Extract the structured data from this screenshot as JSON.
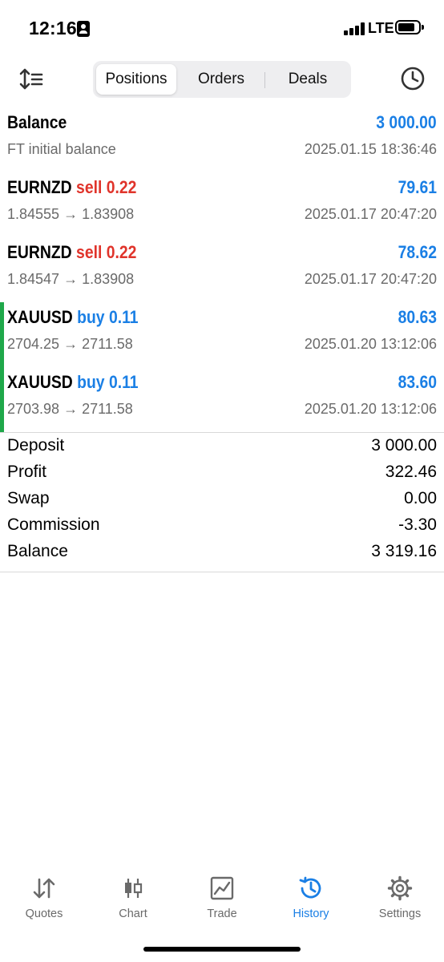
{
  "status_bar": {
    "time": "12:16",
    "network": "LTE"
  },
  "header": {
    "tabs": [
      {
        "label": "Positions",
        "active": true
      },
      {
        "label": "Orders",
        "active": false
      },
      {
        "label": "Deals",
        "active": false
      }
    ],
    "icons": {
      "sort": "sort-icon",
      "history_period": "clock-icon"
    }
  },
  "rows": [
    {
      "symbol": "Balance",
      "side": "",
      "value": "3 000.00",
      "detail": "FT initial balance",
      "time": "2025.01.15 18:36:46",
      "accent": false
    },
    {
      "symbol": "EURNZD",
      "side": "sell 0.22",
      "side_type": "sell",
      "value": "79.61",
      "detail": "1.84555 → 1.83908",
      "time": "2025.01.17 20:47:20",
      "accent": false
    },
    {
      "symbol": "EURNZD",
      "side": "sell 0.22",
      "side_type": "sell",
      "value": "78.62",
      "detail": "1.84547 → 1.83908",
      "time": "2025.01.17 20:47:20",
      "accent": false
    },
    {
      "symbol": "XAUUSD",
      "side": "buy 0.11",
      "side_type": "buy",
      "value": "80.63",
      "detail": "2704.25 → 2711.58",
      "time": "2025.01.20 13:12:06",
      "accent": true
    },
    {
      "symbol": "XAUUSD",
      "side": "buy 0.11",
      "side_type": "buy",
      "value": "83.60",
      "detail": "2703.98 → 2711.58",
      "time": "2025.01.20 13:12:06",
      "accent": true
    }
  ],
  "summary": [
    {
      "label": "Deposit",
      "value": "3 000.00"
    },
    {
      "label": "Profit",
      "value": "322.46"
    },
    {
      "label": "Swap",
      "value": "0.00"
    },
    {
      "label": "Commission",
      "value": "-3.30"
    },
    {
      "label": "Balance",
      "value": "3 319.16"
    }
  ],
  "tabbar": [
    {
      "label": "Quotes",
      "icon": "quotes-icon",
      "active": false
    },
    {
      "label": "Chart",
      "icon": "chart-icon",
      "active": false
    },
    {
      "label": "Trade",
      "icon": "trade-icon",
      "active": false
    },
    {
      "label": "History",
      "icon": "history-icon",
      "active": true
    },
    {
      "label": "Settings",
      "icon": "gear-icon",
      "active": false
    }
  ],
  "colors": {
    "accent_blue": "#1a7fe5",
    "sell_red": "#e0342b",
    "buy_green_bar": "#1fa84a"
  }
}
